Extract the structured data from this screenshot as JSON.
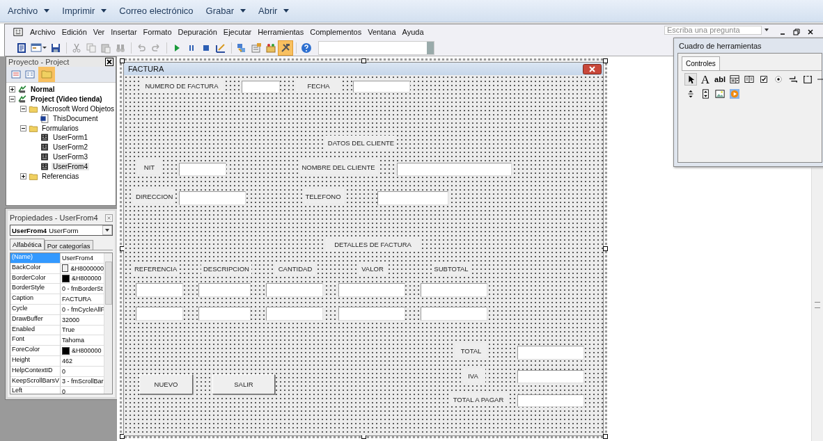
{
  "command_bar": [
    {
      "label": "Archivo",
      "dropdown": true
    },
    {
      "label": "Imprimir",
      "dropdown": true
    },
    {
      "label": "Correo electrónico",
      "dropdown": false
    },
    {
      "label": "Grabar",
      "dropdown": true
    },
    {
      "label": "Abrir",
      "dropdown": true
    }
  ],
  "menu": [
    "Archivo",
    "Edición",
    "Ver",
    "Insertar",
    "Formato",
    "Depuración",
    "Ejecutar",
    "Herramientas",
    "Complementos",
    "Ventana",
    "Ayuda"
  ],
  "ask_field": {
    "placeholder": "Escriba una pregunta"
  },
  "toolbar": [
    {
      "kind": "word",
      "selected": false
    },
    {
      "kind": "form",
      "selected": false
    },
    {
      "kind": "save",
      "selected": false
    },
    {
      "kind": "cut",
      "selected": false
    },
    {
      "kind": "copy",
      "selected": false
    },
    {
      "kind": "paste",
      "selected": false
    },
    {
      "kind": "find",
      "selected": false
    },
    {
      "kind": "undo",
      "selected": false
    },
    {
      "kind": "redo",
      "selected": false
    },
    {
      "kind": "run",
      "selected": false
    },
    {
      "kind": "pause",
      "selected": false
    },
    {
      "kind": "stop",
      "selected": false
    },
    {
      "kind": "design",
      "selected": false
    },
    {
      "kind": "project",
      "selected": false
    },
    {
      "kind": "properties",
      "selected": false
    },
    {
      "kind": "browser",
      "selected": false
    },
    {
      "kind": "toolbox",
      "selected": true
    },
    {
      "kind": "help",
      "selected": false
    }
  ],
  "project_panel": {
    "title": "Proyecto - Project",
    "tree": [
      {
        "label": "Normal",
        "kind": "project",
        "expanded": false,
        "selected": false
      },
      {
        "label": "Project (Video tienda)",
        "kind": "project",
        "expanded": true,
        "selected": false,
        "children": [
          {
            "label": "Microsoft Word Objetos",
            "kind": "folder",
            "expanded": true,
            "selected": false,
            "children": [
              {
                "label": "ThisDocument",
                "kind": "document",
                "selected": false
              }
            ]
          },
          {
            "label": "Formularios",
            "kind": "folder",
            "expanded": true,
            "selected": false,
            "children": [
              {
                "label": "UserForm1",
                "kind": "form",
                "selected": false
              },
              {
                "label": "UserForm2",
                "kind": "form",
                "selected": false
              },
              {
                "label": "UserForm3",
                "kind": "form",
                "selected": false
              },
              {
                "label": "UserFrom4",
                "kind": "form",
                "selected": true
              }
            ]
          },
          {
            "label": "Referencias",
            "kind": "folder",
            "expanded": false,
            "selected": false
          }
        ]
      }
    ]
  },
  "properties_panel": {
    "title": "Propiedades - UserFrom4",
    "object": {
      "name": "UserFrom4",
      "type": "UserForm"
    },
    "tabs": [
      {
        "label": "Alfabética",
        "selected": true
      },
      {
        "label": "Por categorías",
        "selected": false
      }
    ],
    "rows": [
      {
        "name": "(Name)",
        "value": "UserFrom4",
        "selected": true
      },
      {
        "name": "BackColor",
        "value": "&H8000000",
        "color": "#f0f0f0",
        "selected": false
      },
      {
        "name": "BorderColor",
        "value": "&H800000",
        "color": "#000000",
        "selected": false
      },
      {
        "name": "BorderStyle",
        "value": "0 - fmBorderSt",
        "selected": false
      },
      {
        "name": "Caption",
        "value": "FACTURA",
        "selected": false
      },
      {
        "name": "Cycle",
        "value": "0 - fmCycleAllF",
        "selected": false
      },
      {
        "name": "DrawBuffer",
        "value": "32000",
        "selected": false
      },
      {
        "name": "Enabled",
        "value": "True",
        "selected": false
      },
      {
        "name": "Font",
        "value": "Tahoma",
        "selected": false
      },
      {
        "name": "ForeColor",
        "value": "&H800000",
        "color": "#000000",
        "selected": false
      },
      {
        "name": "Height",
        "value": "462",
        "selected": false
      },
      {
        "name": "HelpContextID",
        "value": "0",
        "selected": false
      },
      {
        "name": "KeepScrollBarsV",
        "value": "3 - fmScrollBar",
        "selected": false
      },
      {
        "name": "Left",
        "value": "0",
        "selected": false
      }
    ]
  },
  "form": {
    "title": "FACTURA",
    "controls": [
      {
        "kind": "label",
        "text": "NUMERO DE FACTURA"
      },
      {
        "kind": "textbox"
      },
      {
        "kind": "label",
        "text": "FECHA"
      },
      {
        "kind": "textbox"
      },
      {
        "kind": "label",
        "text": "DATOS DEL CLIENTE"
      },
      {
        "kind": "label",
        "text": "NIT"
      },
      {
        "kind": "textbox"
      },
      {
        "kind": "label",
        "text": "NOMBRE DEL CLIENTE"
      },
      {
        "kind": "textbox"
      },
      {
        "kind": "label",
        "text": "DIRECCION"
      },
      {
        "kind": "textbox"
      },
      {
        "kind": "label",
        "text": "TELEFONO"
      },
      {
        "kind": "textbox"
      },
      {
        "kind": "label",
        "text": "DETALLES DE FACTURA"
      },
      {
        "kind": "label",
        "text": "REFERENCIA"
      },
      {
        "kind": "label",
        "text": "DESCRIPCION"
      },
      {
        "kind": "label",
        "text": "CANTIDAD"
      },
      {
        "kind": "label",
        "text": "VALOR"
      },
      {
        "kind": "label",
        "text": "SUBTOTAL"
      },
      {
        "kind": "textbox"
      },
      {
        "kind": "textbox"
      },
      {
        "kind": "textbox"
      },
      {
        "kind": "textbox"
      },
      {
        "kind": "textbox"
      },
      {
        "kind": "textbox"
      },
      {
        "kind": "textbox"
      },
      {
        "kind": "textbox"
      },
      {
        "kind": "textbox"
      },
      {
        "kind": "textbox"
      },
      {
        "kind": "label",
        "text": "TOTAL"
      },
      {
        "kind": "textbox"
      },
      {
        "kind": "label",
        "text": "IVA"
      },
      {
        "kind": "textbox"
      },
      {
        "kind": "button",
        "text": "NUEVO"
      },
      {
        "kind": "button",
        "text": "SALIR"
      },
      {
        "kind": "label",
        "text": "TOTAL A PAGAR"
      },
      {
        "kind": "textbox"
      }
    ]
  },
  "toolbox": {
    "title": "Cuadro de herramientas",
    "tabs": [
      {
        "label": "Controles",
        "selected": true
      }
    ],
    "tools": [
      {
        "kind": "pointer",
        "selected": true
      },
      {
        "kind": "label",
        "glyph": "A",
        "selected": false
      },
      {
        "kind": "textbox",
        "glyph": "abl",
        "selected": false
      },
      {
        "kind": "combo",
        "selected": false
      },
      {
        "kind": "list",
        "selected": false
      },
      {
        "kind": "check",
        "selected": false
      },
      {
        "kind": "option",
        "selected": false
      },
      {
        "kind": "toggle",
        "selected": false
      },
      {
        "kind": "frame",
        "selected": false
      },
      {
        "kind": "line",
        "selected": false
      },
      {
        "kind": "spin",
        "selected": false
      },
      {
        "kind": "scroll",
        "selected": false
      },
      {
        "kind": "image",
        "selected": false
      },
      {
        "kind": "media",
        "selected": false
      }
    ]
  }
}
